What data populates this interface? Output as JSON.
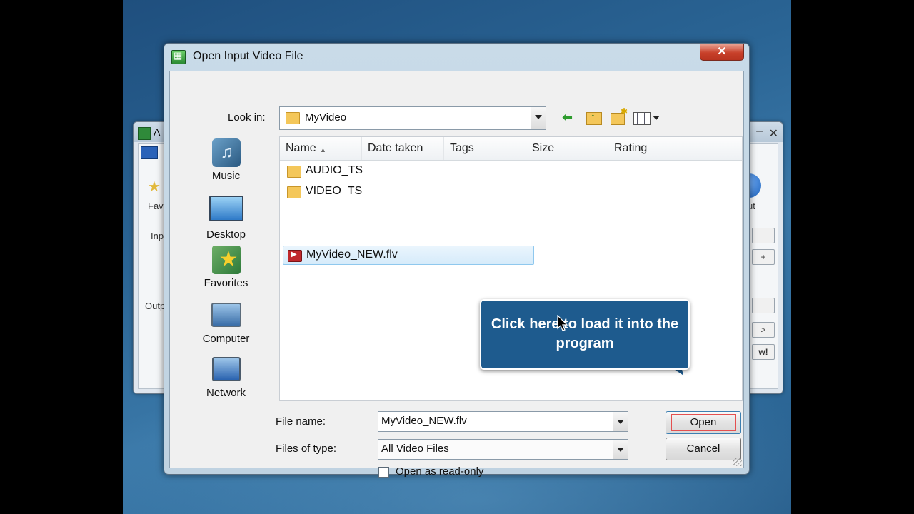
{
  "background_app": {
    "title": "A",
    "labels": {
      "fav": "Fav",
      "inp": "Inp",
      "outp": "Outp",
      "ut": "ut",
      "new": "w!"
    },
    "buttons": [
      "+",
      ">"
    ]
  },
  "dialog": {
    "title": "Open Input Video File",
    "close_label": "✕",
    "look_in_label": "Look in:",
    "look_in_value": "MyVideo",
    "toolbar": {
      "back_icon": "back-arrow-icon",
      "up_icon": "up-one-level-icon",
      "new_folder_icon": "new-folder-icon",
      "views_icon": "views-menu-icon"
    },
    "places": [
      {
        "label": "Music",
        "icon": "music-icon"
      },
      {
        "label": "Desktop",
        "icon": "desktop-icon"
      },
      {
        "label": "Favorites",
        "icon": "favorites-icon"
      },
      {
        "label": "Computer",
        "icon": "computer-icon"
      },
      {
        "label": "Network",
        "icon": "network-icon"
      }
    ],
    "columns": [
      "Name",
      "Date taken",
      "Tags",
      "Size",
      "Rating"
    ],
    "files": [
      {
        "name": "AUDIO_TS",
        "type": "folder"
      },
      {
        "name": "VIDEO_TS",
        "type": "folder"
      },
      {
        "name": "MyVideo_NEW.flv",
        "type": "flv",
        "selected": true
      }
    ],
    "file_name_label": "File name:",
    "file_name_value": "MyVideo_NEW.flv",
    "files_of_type_label": "Files of type:",
    "files_of_type_value": "All Video Files",
    "readonly_label": "Open as read-only",
    "readonly_checked": false,
    "open_button": "Open",
    "cancel_button": "Cancel"
  },
  "callout": {
    "text": "Click here to load it into the program"
  }
}
